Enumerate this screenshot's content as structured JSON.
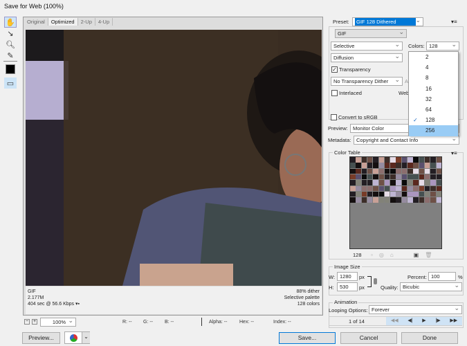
{
  "window": {
    "title": "Save for Web (100%)"
  },
  "tools": [
    "hand-tool",
    "slice-select-tool",
    "zoom-tool",
    "eyedropper-tool",
    "eyedropper-color",
    "toggle-slices"
  ],
  "tabs": [
    "Original",
    "Optimized",
    "2-Up",
    "4-Up"
  ],
  "info": {
    "format": "GIF",
    "size": "2.177M",
    "time": "404 sec @ 56.6 Kbps",
    "dither": "88% dither",
    "palette": "Selective palette",
    "colors": "128 colors"
  },
  "statusbar": {
    "zoom": "100%",
    "r": "R: --",
    "g": "G: --",
    "b": "B: --",
    "alpha": "Alpha: --",
    "hex": "Hex: --",
    "index": "Index: --"
  },
  "bottom": {
    "preview": "Preview...",
    "save": "Save...",
    "cancel": "Cancel",
    "done": "Done"
  },
  "settings": {
    "preset_label": "Preset:",
    "preset": "GIF 128 Dithered",
    "format": "GIF",
    "reduction": "Selective",
    "colors_label": "Colors:",
    "colors": "128",
    "dither": "Diffusion",
    "transparency": "Transparency",
    "transparency_dither": "No Transparency Dither",
    "a_label": "A",
    "interlaced": "Interlaced",
    "web_label": "Web",
    "convert": "Convert to sRGB",
    "preview_label": "Preview:",
    "preview": "Monitor Color",
    "metadata_label": "Metadata:",
    "metadata": "Copyright and Contact Info"
  },
  "colors_dropdown": {
    "options": [
      "2",
      "4",
      "8",
      "16",
      "32",
      "64",
      "128",
      "256"
    ],
    "selected": "128",
    "highlighted": "256"
  },
  "color_table": {
    "title": "Color Table",
    "count": "128"
  },
  "image_size": {
    "title": "Image Size",
    "w_label": "W:",
    "w": "1280",
    "h_label": "H:",
    "h": "530",
    "unit": "px",
    "percent_label": "Percent:",
    "percent": "100",
    "pct": "%",
    "quality_label": "Quality:",
    "quality": "Bicubic"
  },
  "animation": {
    "title": "Animation",
    "looping_label": "Looping Options:",
    "looping": "Forever",
    "frame": "1 of 14"
  }
}
